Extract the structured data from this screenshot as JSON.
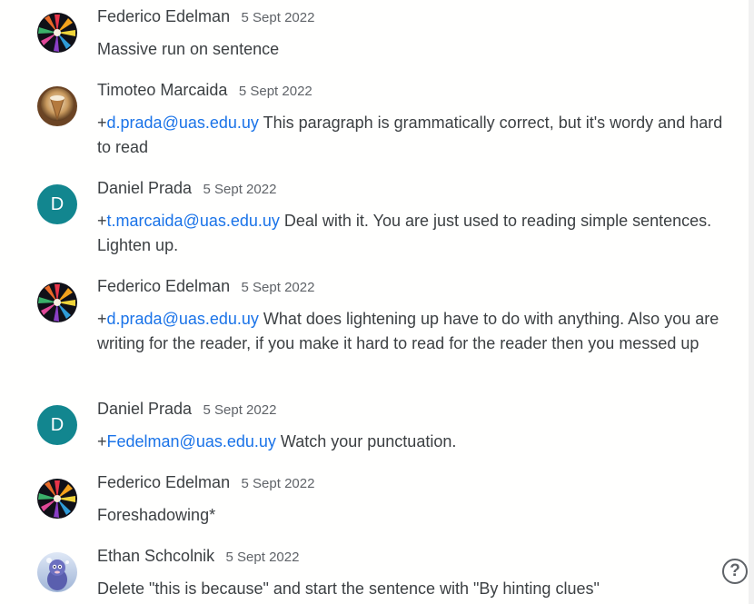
{
  "comments": [
    {
      "author": "Federico Edelman",
      "date": "5 Sept 2022",
      "avatar": "flower-photo",
      "mention_prefix": "",
      "mention": "",
      "text": "Massive run on sentence"
    },
    {
      "author": "Timoteo Marcaida",
      "date": "5 Sept 2022",
      "avatar": "cone-photo",
      "mention_prefix": "+",
      "mention": "d.prada@uas.edu.uy",
      "text": " This paragraph is grammatically correct, but it's wordy and hard to read"
    },
    {
      "author": "Daniel Prada",
      "date": "5 Sept 2022",
      "avatar_letter": "D",
      "mention_prefix": "+",
      "mention": "t.marcaida@uas.edu.uy",
      "text": " Deal with it. You are just used to reading simple sentences. Lighten up."
    },
    {
      "author": "Federico Edelman",
      "date": "5 Sept 2022",
      "avatar": "flower-photo",
      "mention_prefix": "+",
      "mention": "d.prada@uas.edu.uy",
      "text": " What does lightening up have to do with anything. Also you are writing for the reader, if you make it hard to read for the reader then you messed up"
    },
    {
      "author": "Daniel Prada",
      "date": "5 Sept 2022",
      "avatar_letter": "D",
      "mention_prefix": "+",
      "mention": "Fedelman@uas.edu.uy",
      "text": " Watch your punctuation."
    },
    {
      "author": "Federico Edelman",
      "date": "5 Sept 2022",
      "avatar": "flower-photo",
      "mention_prefix": "",
      "mention": "",
      "text": "Foreshadowing*"
    },
    {
      "author": "Ethan Schcolnik",
      "date": "5 Sept 2022",
      "avatar": "creature-photo",
      "mention_prefix": "",
      "mention": "",
      "text": "Delete \"this is because\" and start the sentence with \"By hinting clues\""
    }
  ],
  "help": {
    "icon": "help-circle-icon",
    "glyph": "?"
  },
  "colors": {
    "mention": "#1a73e8",
    "letter_avatar_bg": "#12868f",
    "text": "#3c4043",
    "date": "#5f6368"
  }
}
